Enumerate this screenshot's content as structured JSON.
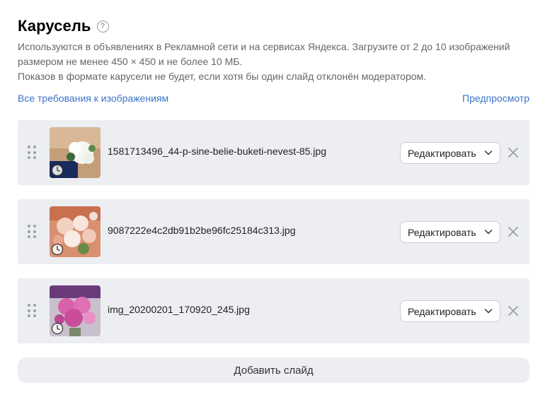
{
  "header": {
    "title": "Карусель",
    "help_icon": "?"
  },
  "description": {
    "line1": "Используются в объявлениях в Рекламной сети и на сервисах Яндекса. Загрузите от 2 до 10 изображений",
    "line2": "размером не менее 450 × 450 и не более 10 МБ.",
    "line3": "Показов в формате карусели не будет, если хотя бы один слайд отклонён модератором."
  },
  "links": {
    "requirements": "Все требования к изображениям",
    "preview": "Предпросмотр"
  },
  "slides": [
    {
      "filename": "1581713496_44-p-sine-belie-buketi-nevest-85.jpg",
      "edit_label": "Редактировать",
      "thumb_colors": [
        "#c8a27a",
        "#ffffff",
        "#1a2a5c"
      ],
      "status_icon": "clock-icon"
    },
    {
      "filename": "9087222e4c2db91b2be96fc25184c313.jpg",
      "edit_label": "Редактировать",
      "thumb_colors": [
        "#e8b8a0",
        "#f4d4c8",
        "#6a8a4a"
      ],
      "status_icon": "clock-icon"
    },
    {
      "filename": "img_20200201_170920_245.jpg",
      "edit_label": "Редактировать",
      "thumb_colors": [
        "#d860a8",
        "#e890c8",
        "#b8b0c0"
      ],
      "status_icon": "clock-icon"
    }
  ],
  "add_slide_label": "Добавить слайд",
  "colors": {
    "link": "#3b73c9",
    "slide_bg": "#eceef2",
    "muted_text": "#666666"
  }
}
